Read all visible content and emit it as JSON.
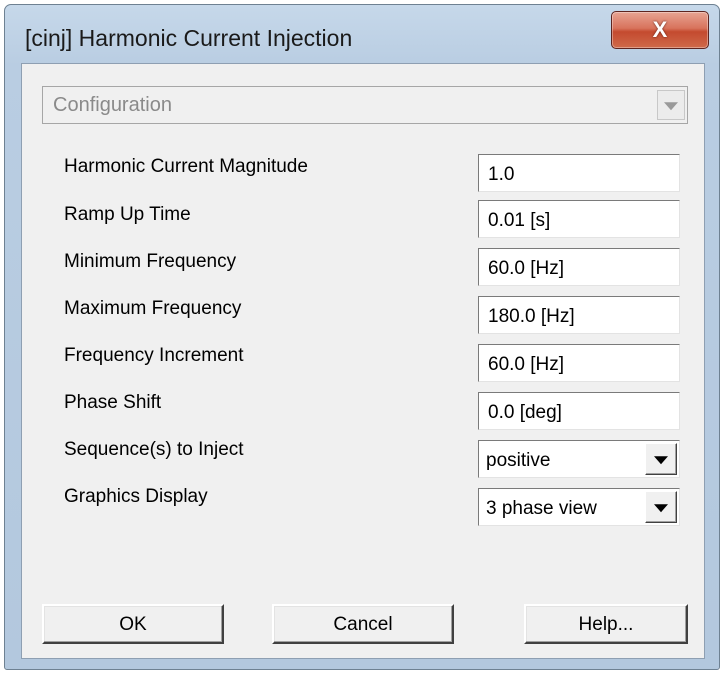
{
  "window": {
    "title": "[cinj] Harmonic Current Injection",
    "close_glyph": "X"
  },
  "configuration": {
    "value": "Configuration"
  },
  "fields": {
    "harmonic_current_magnitude": {
      "label": "Harmonic Current Magnitude",
      "value": "1.0"
    },
    "ramp_up_time": {
      "label": "Ramp Up Time",
      "value": "0.01 [s]"
    },
    "minimum_frequency": {
      "label": "Minimum Frequency",
      "value": "60.0 [Hz]"
    },
    "maximum_frequency": {
      "label": "Maximum Frequency",
      "value": "180.0 [Hz]"
    },
    "frequency_increment": {
      "label": "Frequency Increment",
      "value": "60.0 [Hz]"
    },
    "phase_shift": {
      "label": "Phase Shift",
      "value": "0.0 [deg]"
    }
  },
  "selects": {
    "sequences_to_inject": {
      "label": "Sequence(s) to Inject",
      "value": "positive"
    },
    "graphics_display": {
      "label": "Graphics Display",
      "value": "3 phase view"
    }
  },
  "buttons": {
    "ok": "OK",
    "cancel": "Cancel",
    "help": "Help..."
  },
  "colors": {
    "title_bar": "#b9cde2",
    "client_bg": "#f0f0f0",
    "close_button": "#c44a2f"
  }
}
